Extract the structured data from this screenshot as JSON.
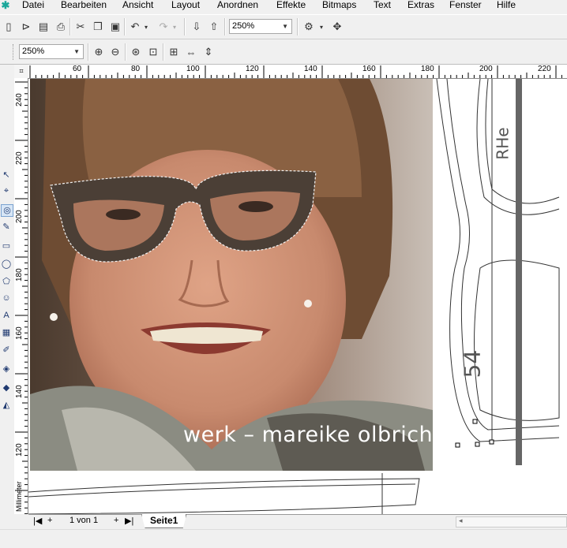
{
  "menubar": {
    "items": [
      {
        "label": "Datei"
      },
      {
        "label": "Bearbeiten"
      },
      {
        "label": "Ansicht"
      },
      {
        "label": "Layout"
      },
      {
        "label": "Anordnen"
      },
      {
        "label": "Effekte"
      },
      {
        "label": "Bitmaps"
      },
      {
        "label": "Text"
      },
      {
        "label": "Extras"
      },
      {
        "label": "Fenster"
      },
      {
        "label": "Hilfe"
      }
    ]
  },
  "toolbar": {
    "zoom_value": "250%"
  },
  "zoombar": {
    "zoom_value": "250%"
  },
  "ruler": {
    "h_labels": [
      "60",
      "80",
      "100",
      "120",
      "140",
      "160",
      "180",
      "200",
      "220"
    ],
    "v_labels": [
      "240",
      "220",
      "200",
      "180",
      "160",
      "140",
      "120"
    ],
    "unit": "Millimeter"
  },
  "canvas": {
    "caption": "werk – mareike olbrich",
    "template_text_1": "54",
    "template_text_2": "RHe"
  },
  "pagebar": {
    "page_counter": "1 von 1",
    "page_tab": "Seite1"
  },
  "colors": {
    "accent": "#1aa79a",
    "frame_dark": "#4b3f36",
    "skin": "#c98d72"
  }
}
